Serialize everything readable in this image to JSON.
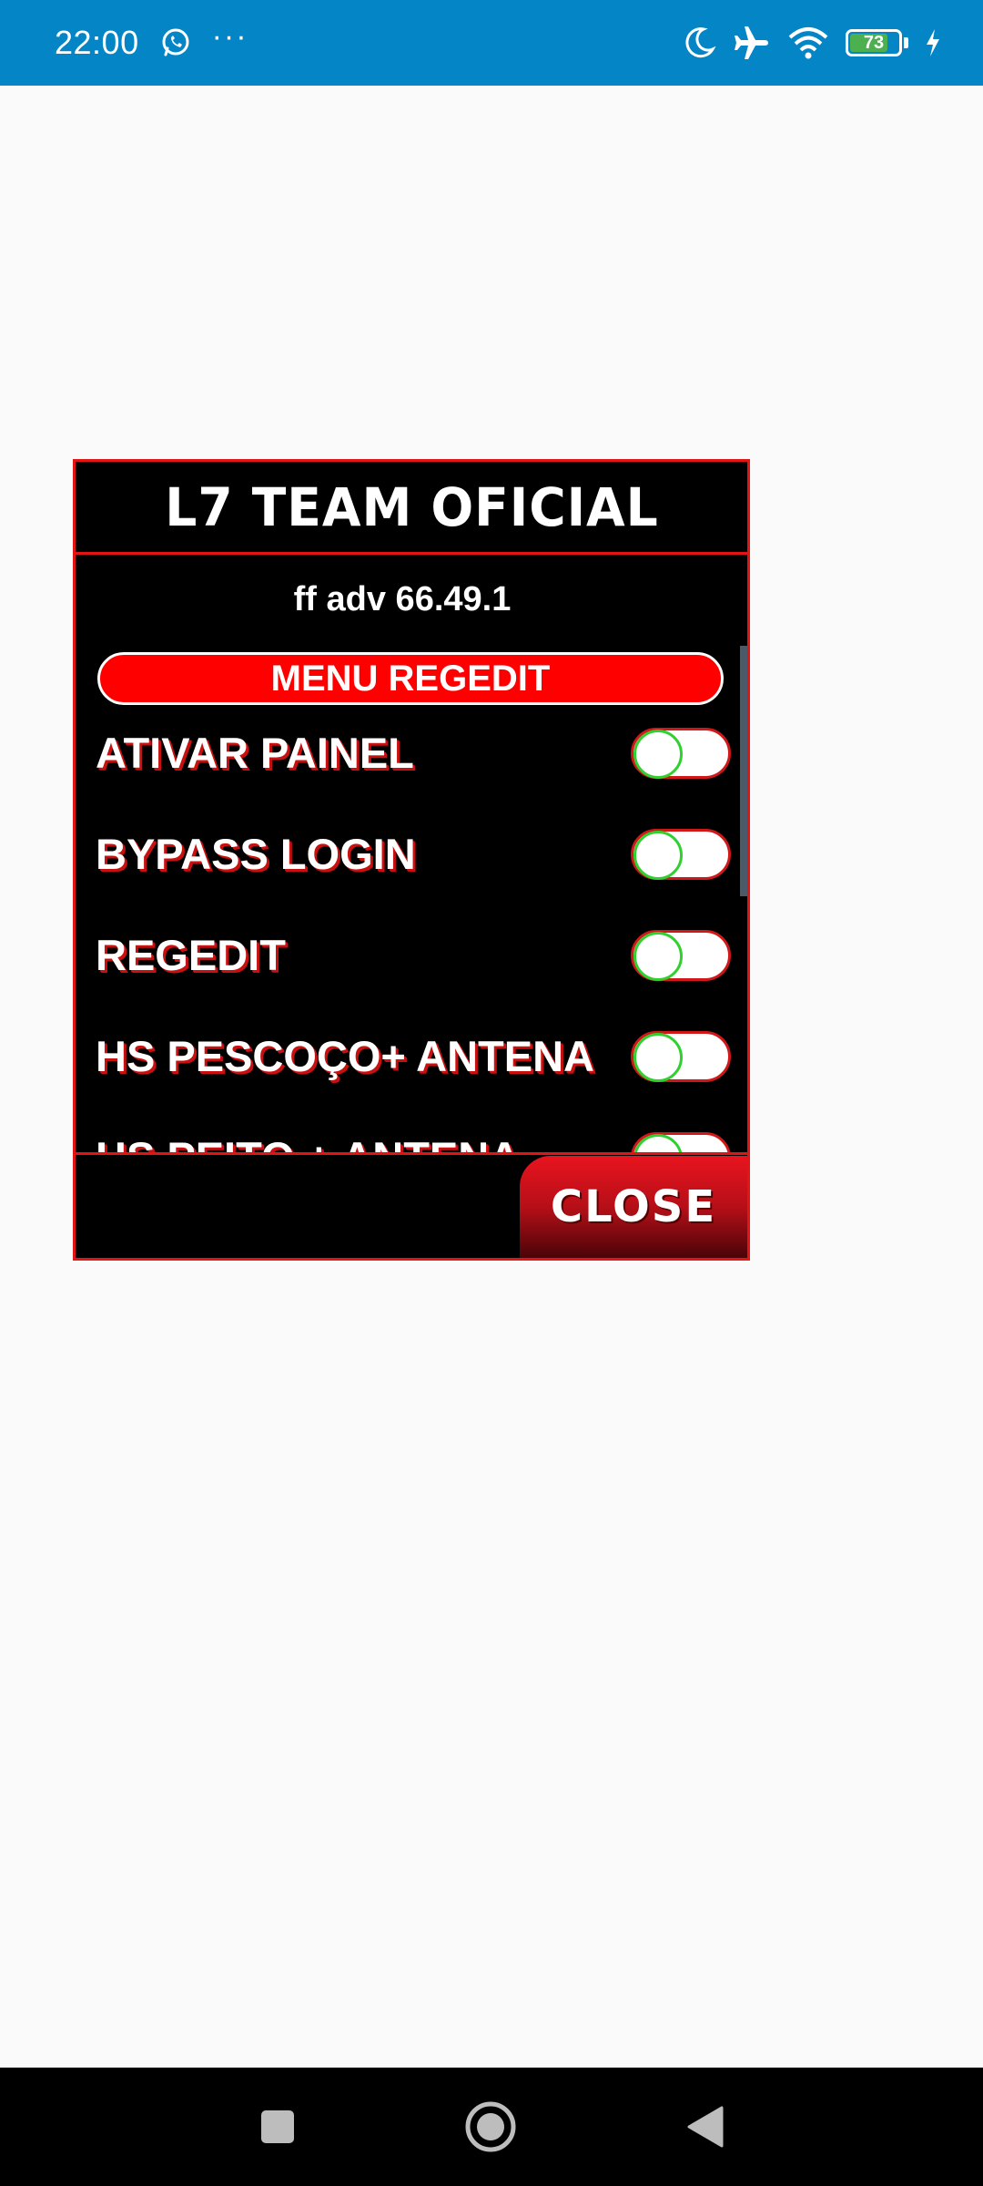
{
  "status_bar": {
    "time": "22:00",
    "more": "···",
    "battery_level": "73",
    "icons": [
      "whatsapp-icon",
      "moon-icon",
      "airplane-icon",
      "wifi-icon",
      "battery-icon",
      "charging-icon"
    ]
  },
  "panel": {
    "title": "L7 TEAM OFICIAL",
    "version": "ff adv 66.49.1",
    "section_title": "MENU REGEDIT",
    "toggles": [
      {
        "label": "ATIVAR PAINEL",
        "on": false
      },
      {
        "label": "BYPASS LOGIN",
        "on": false
      },
      {
        "label": "REGEDIT",
        "on": false
      },
      {
        "label": "HS PESCOÇO+ ANTENA",
        "on": false
      },
      {
        "label": "HS PEITO + ANTENA",
        "on": false
      }
    ],
    "close_label": "CLOSE"
  },
  "colors": {
    "status_bar": "#0385c6",
    "panel_border": "#e31414",
    "section_bar": "#ff0000",
    "toggle_knob_border": "#2fd02f"
  },
  "nav_bar": {
    "icons": [
      "square-recents-icon",
      "circle-home-icon",
      "triangle-back-icon"
    ]
  }
}
